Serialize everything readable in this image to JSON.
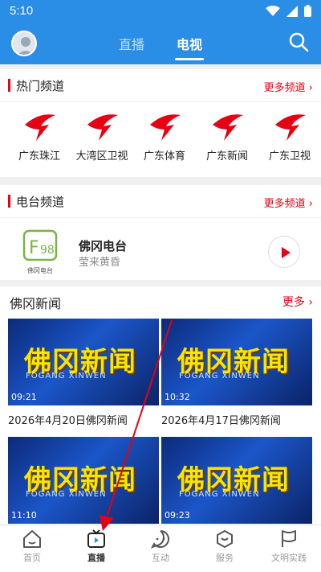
{
  "status": {
    "time": "5:10"
  },
  "header": {
    "tabs": [
      {
        "label": "直播"
      },
      {
        "label": "电视"
      }
    ]
  },
  "hot_channels": {
    "title": "热门频道",
    "more": "更多频道 ›",
    "items": [
      {
        "label": "广东珠江"
      },
      {
        "label": "大湾区卫视"
      },
      {
        "label": "广东体育"
      },
      {
        "label": "广东新闻"
      },
      {
        "label": "广东卫视"
      }
    ]
  },
  "radio": {
    "title": "电台频道",
    "more": "更多频道 ›",
    "name": "佛冈电台",
    "subtitle": "莹来黄昏",
    "logo_text": "佛冈电台"
  },
  "news": {
    "title": "佛冈新闻",
    "more": "更多 ›",
    "thumb_title": "佛冈新闻",
    "thumb_sub": "FOGANG XINWEN",
    "items": [
      {
        "duration": "09:21",
        "caption": "2026年4月20日佛冈新闻"
      },
      {
        "duration": "10:32",
        "caption": "2026年4月17日佛冈新闻"
      },
      {
        "duration": "11:10",
        "caption": ""
      },
      {
        "duration": "09:23",
        "caption": ""
      }
    ]
  },
  "bottom_nav": [
    {
      "label": "首页"
    },
    {
      "label": "直播"
    },
    {
      "label": "互动"
    },
    {
      "label": "服务"
    },
    {
      "label": "文明实践"
    }
  ],
  "colors": {
    "brand_blue": "#2a8ee6",
    "accent_red": "#e60012"
  }
}
